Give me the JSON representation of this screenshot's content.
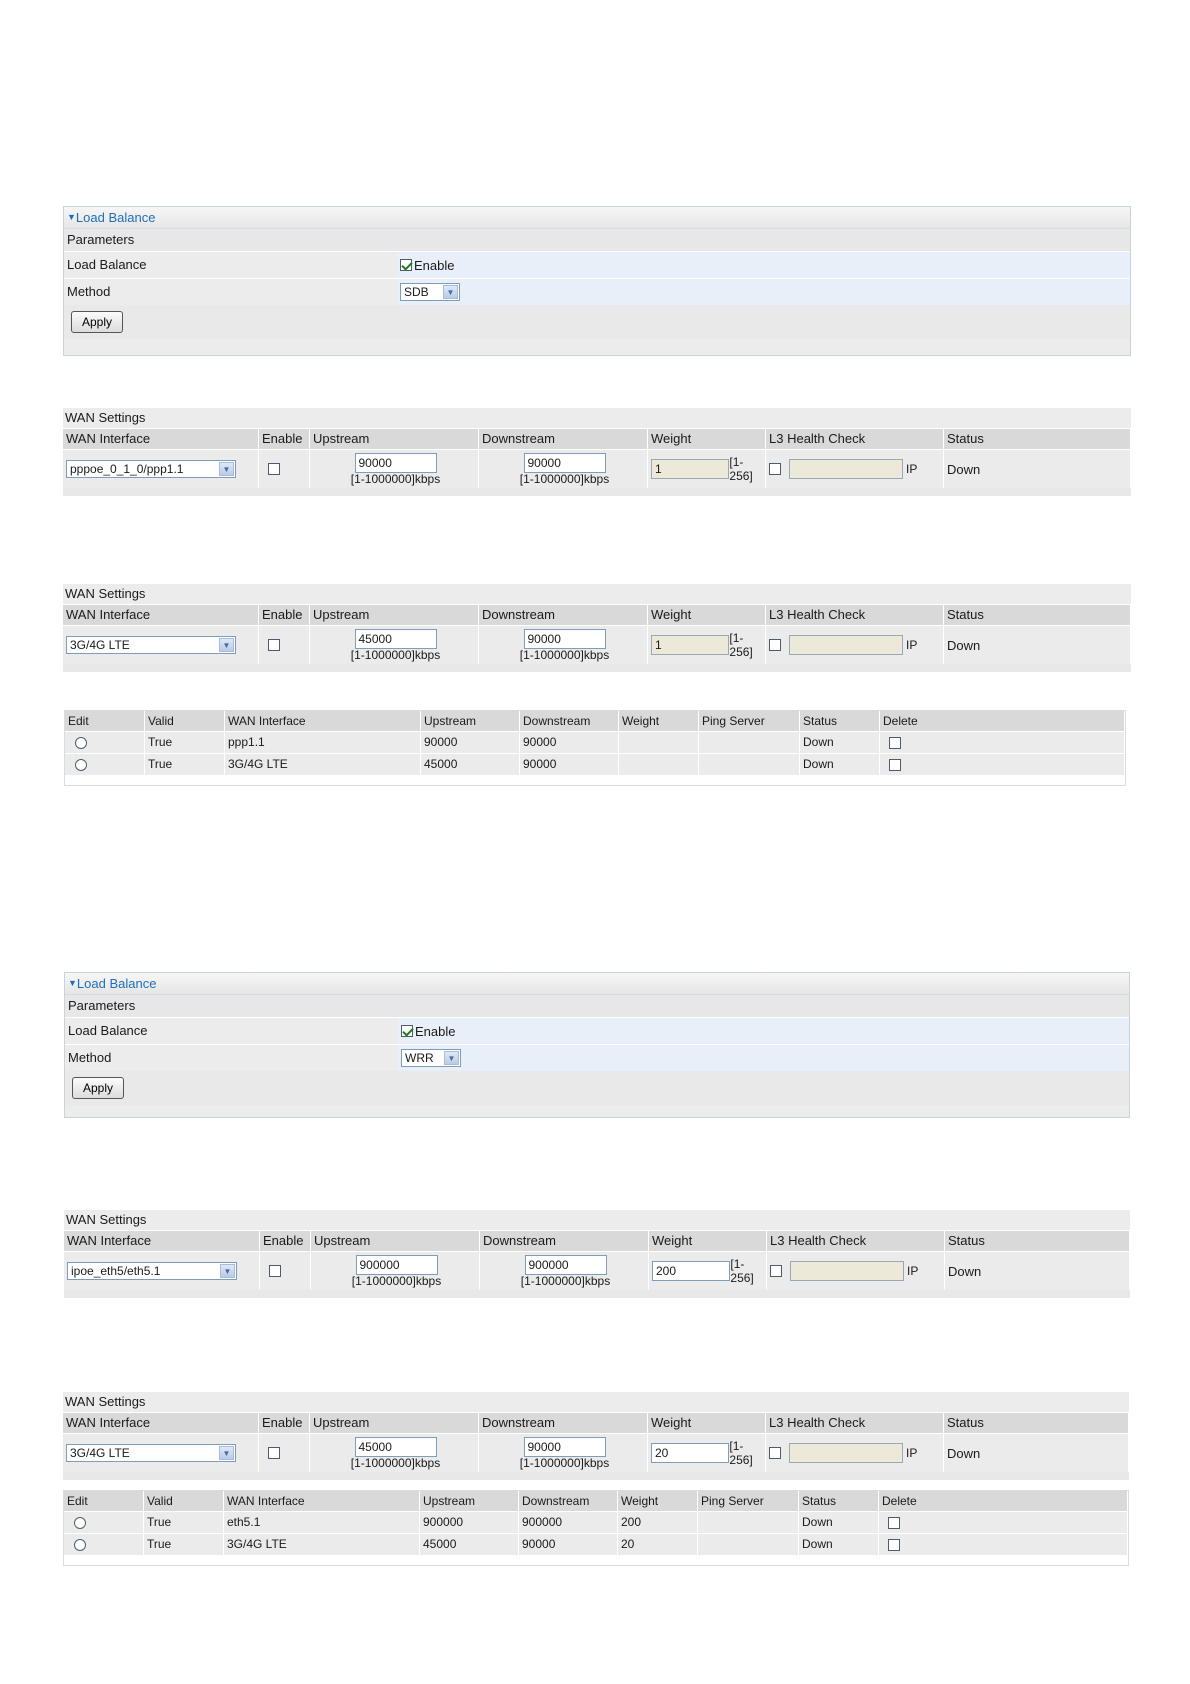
{
  "fig1": {
    "title": "Load Balance",
    "params_header": "Parameters",
    "lb_label": "Load Balance",
    "enable_label": "Enable",
    "method_label": "Method",
    "method_value": "SDB",
    "apply_label": "Apply"
  },
  "wan1": {
    "section_title": "WAN Settings",
    "headers": [
      "WAN Interface",
      "Enable",
      "Upstream",
      "Downstream",
      "Weight",
      "L3 Health Check",
      "Status"
    ],
    "interface": "pppoe_0_1_0/ppp1.1",
    "upstream": "90000",
    "downstream": "90000",
    "unit": "[1-1000000]kbps",
    "weight": "1",
    "weight_range": "[1-256]",
    "ip_label": "IP",
    "status": "Down"
  },
  "wan2": {
    "section_title": "WAN Settings",
    "headers": [
      "WAN Interface",
      "Enable",
      "Upstream",
      "Downstream",
      "Weight",
      "L3 Health Check",
      "Status"
    ],
    "interface": "3G/4G LTE",
    "upstream": "45000",
    "downstream": "90000",
    "unit": "[1-1000000]kbps",
    "weight": "1",
    "weight_range": "[1-256]",
    "ip_label": "IP",
    "status": "Down"
  },
  "list1": {
    "headers": [
      "Edit",
      "Valid",
      "WAN Interface",
      "Upstream",
      "Downstream",
      "Weight",
      "Ping Server",
      "Status",
      "Delete"
    ],
    "rows": [
      {
        "valid": "True",
        "iface": "ppp1.1",
        "up": "90000",
        "down": "90000",
        "weight": "",
        "ping": "",
        "status": "Down"
      },
      {
        "valid": "True",
        "iface": "3G/4G LTE",
        "up": "45000",
        "down": "90000",
        "weight": "",
        "ping": "",
        "status": "Down"
      }
    ]
  },
  "fig2": {
    "title": "Load Balance",
    "params_header": "Parameters",
    "lb_label": "Load Balance",
    "enable_label": "Enable",
    "method_label": "Method",
    "method_value": "WRR",
    "apply_label": "Apply"
  },
  "wan3": {
    "section_title": "WAN Settings",
    "headers": [
      "WAN Interface",
      "Enable",
      "Upstream",
      "Downstream",
      "Weight",
      "L3 Health Check",
      "Status"
    ],
    "interface": "ipoe_eth5/eth5.1",
    "upstream": "900000",
    "downstream": "900000",
    "unit": "[1-1000000]kbps",
    "weight": "200",
    "weight_range": "[1-256]",
    "ip_label": "IP",
    "status": "Down"
  },
  "wan4": {
    "section_title": "WAN Settings",
    "headers": [
      "WAN Interface",
      "Enable",
      "Upstream",
      "Downstream",
      "Weight",
      "L3 Health Check",
      "Status"
    ],
    "interface": "3G/4G LTE",
    "upstream": "45000",
    "downstream": "90000",
    "unit": "[1-1000000]kbps",
    "weight": "20",
    "weight_range": "[1-256]",
    "ip_label": "IP",
    "status": "Down"
  },
  "list2": {
    "headers": [
      "Edit",
      "Valid",
      "WAN Interface",
      "Upstream",
      "Downstream",
      "Weight",
      "Ping Server",
      "Status",
      "Delete"
    ],
    "rows": [
      {
        "valid": "True",
        "iface": "eth5.1",
        "up": "900000",
        "down": "900000",
        "weight": "200",
        "ping": "",
        "status": "Down"
      },
      {
        "valid": "True",
        "iface": "3G/4G LTE",
        "up": "45000",
        "down": "90000",
        "weight": "20",
        "ping": "",
        "status": "Down"
      }
    ]
  }
}
